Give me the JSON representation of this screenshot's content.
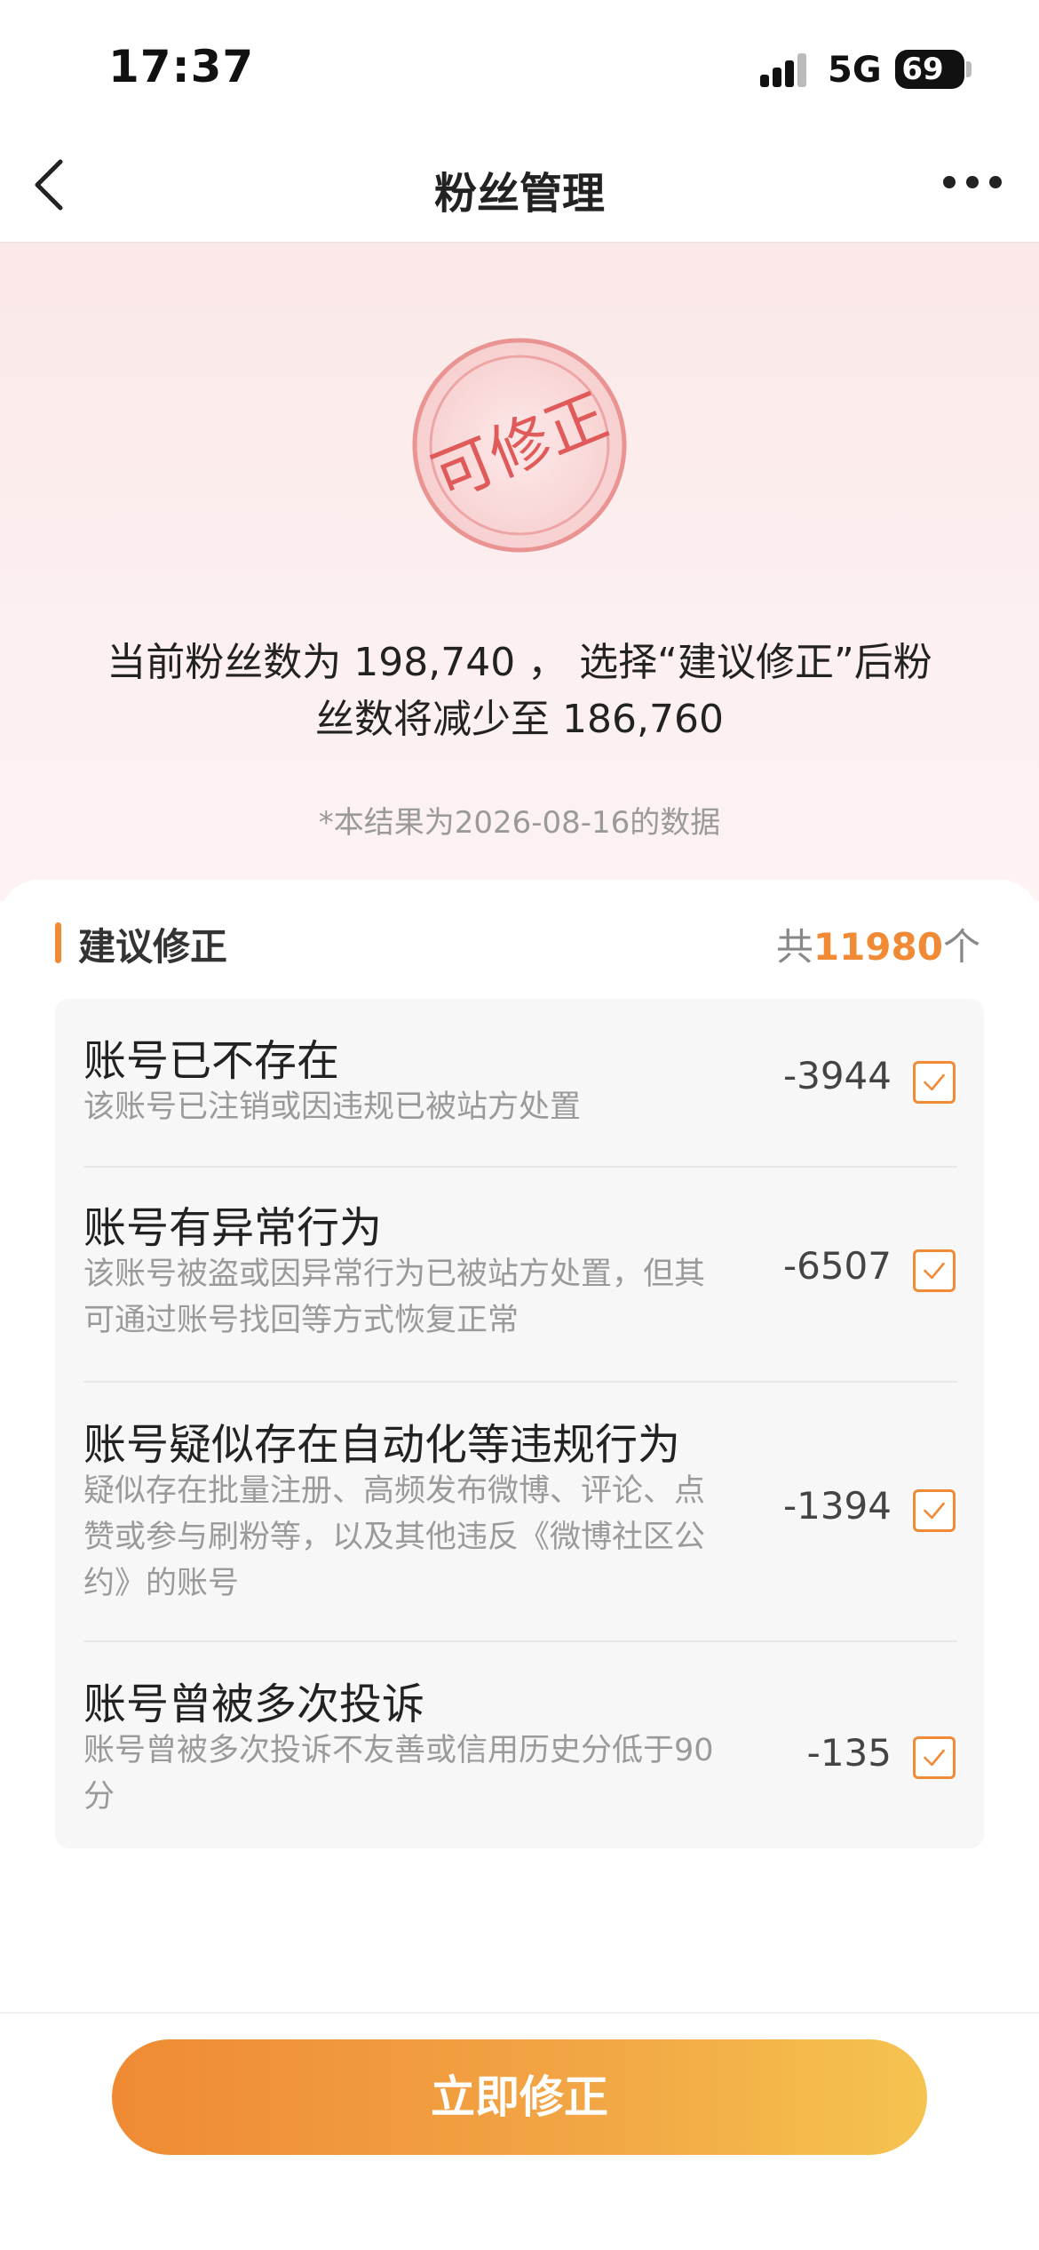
{
  "status_bar": {
    "time": "17:37",
    "network": "5G",
    "battery": "69"
  },
  "nav": {
    "title": "粉丝管理"
  },
  "stamp": {
    "text": "可修正",
    "color": "#e05a5a"
  },
  "summary": {
    "line1": "当前粉丝数为 198,740 ， 选择“建议修正”后粉",
    "line2": "丝数将减少至 186,760"
  },
  "note": "*本结果为2026-08-16的数据",
  "section": {
    "title": "建议修正",
    "total_prefix": "共",
    "total_value": "11980",
    "total_suffix": "个"
  },
  "items": [
    {
      "title": "账号已不存在",
      "desc_lines": [
        "该账号已注销或因违规已被站方处置"
      ],
      "count": "-3944",
      "checked": true
    },
    {
      "title": "账号有异常行为",
      "desc_lines": [
        "该账号被盗或因异常行为已被站方处置，但其",
        "可通过账号找回等方式恢复正常"
      ],
      "count": "-6507",
      "checked": true
    },
    {
      "title": "账号疑似存在自动化等违规行为",
      "desc_lines": [
        "疑似存在批量注册、高频发布微博、评论、点",
        "赞或参与刷粉等，以及其他违反《微博社区公",
        "约》的账号"
      ],
      "count": "-1394",
      "checked": true
    },
    {
      "title": "账号曾被多次投诉",
      "desc_lines": [
        "账号曾被多次投诉不友善或信用历史分低于90",
        "分"
      ],
      "count": "-135",
      "checked": true
    }
  ],
  "button": {
    "label": "立即修正"
  },
  "colors": {
    "accent": "#f08a35",
    "stamp": "#e05a5a"
  }
}
